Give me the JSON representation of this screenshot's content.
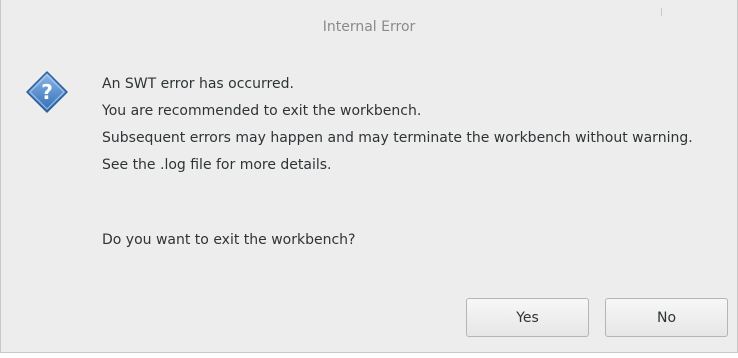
{
  "window": {
    "title": "Internal Error"
  },
  "dialog": {
    "icon": "question-icon",
    "icon_color": "#3c7fc6",
    "messages": [
      "An SWT error has occurred.",
      "You are recommended to exit the workbench.",
      "Subsequent errors may happen and may terminate the workbench without warning.",
      "See the .log file for more details."
    ],
    "question": "Do you want to exit the workbench?"
  },
  "buttons": {
    "yes_label": "Yes",
    "no_label": "No"
  }
}
